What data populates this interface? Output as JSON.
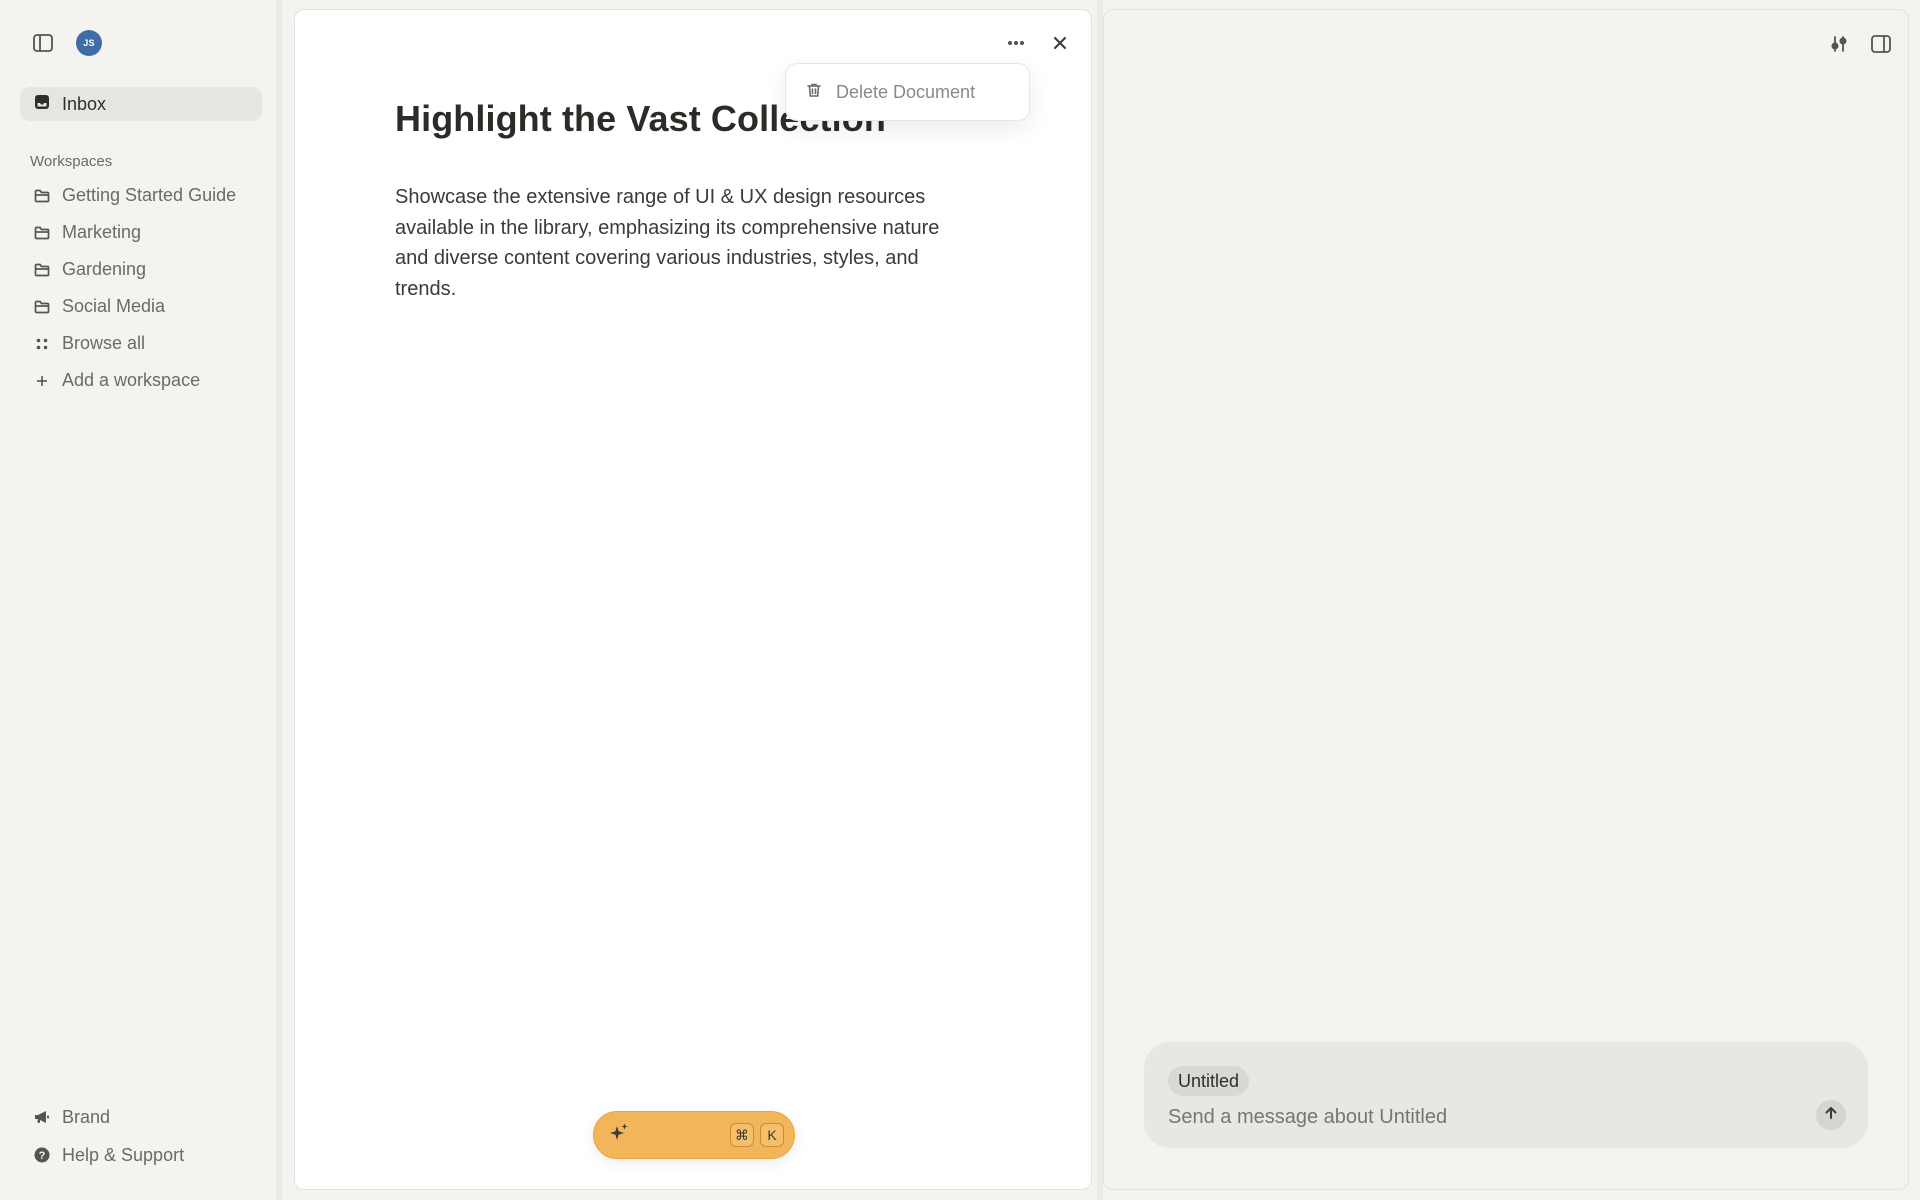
{
  "sidebar": {
    "avatar_initials": "JS",
    "inbox_label": "Inbox",
    "workspaces_title": "Workspaces",
    "workspaces": [
      {
        "label": "Getting Started Guide",
        "icon": "folder-icon"
      },
      {
        "label": "Marketing",
        "icon": "folder-icon"
      },
      {
        "label": "Gardening",
        "icon": "folder-icon"
      },
      {
        "label": "Social Media",
        "icon": "folder-icon"
      },
      {
        "label": "Browse all",
        "icon": "grid-icon"
      },
      {
        "label": "Add a workspace",
        "icon": "plus-icon"
      }
    ],
    "bottom": [
      {
        "label": "Brand",
        "icon": "megaphone-icon"
      },
      {
        "label": "Help & Support",
        "icon": "help-icon"
      }
    ]
  },
  "document": {
    "title": "Highlight the Vast Collection",
    "body": "Showcase the extensive range of UI & UX design resources available in the library, emphasizing its comprehensive nature and diverse content covering various industries, styles, and trends.",
    "menu": {
      "delete_label": "Delete Document"
    },
    "ai_bar": {
      "shortcut_keys": [
        "⌘",
        "K"
      ]
    }
  },
  "chat": {
    "context_pill": "Untitled",
    "input_placeholder": "Send a message about Untitled"
  },
  "colors": {
    "background": "#f4f3f0",
    "accent": "#f2b55a",
    "avatar": "#3f6ea6"
  }
}
